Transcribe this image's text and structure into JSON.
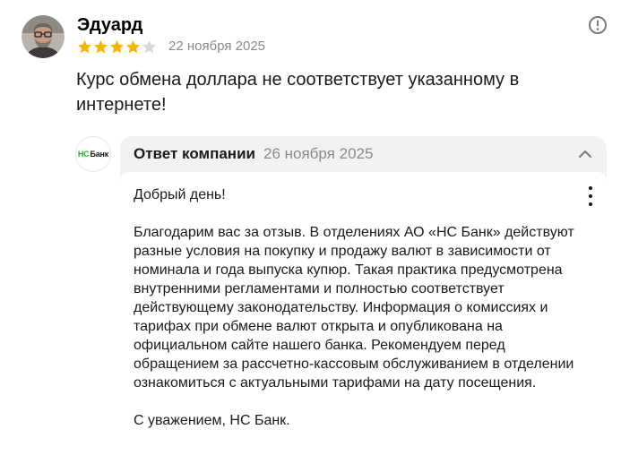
{
  "review": {
    "author_name": "Эдуард",
    "rating": 4,
    "max_rating": 5,
    "date": "22 ноября 2025",
    "text": "Курс обмена доллара не соответствует указанному в интернете!",
    "icons": {
      "avatar": "avatar-photo",
      "more": "info-circle-icon"
    }
  },
  "company_reply": {
    "logo_text_ns": "НС",
    "logo_text_bank": "Банк",
    "title": "Ответ компании",
    "date": "26 ноября 2025",
    "paragraphs": [
      "Добрый день!",
      "Благодарим вас за отзыв. В отделениях АО «НС Банк» действуют разные условия на покупку и продажу валют в зависимости от номинала и года выпуска купюр. Такая практика предусмотрена внутренними регламентами и полностью соответствует действующему законодательству. Информация о комиссиях и тарифах при обмене валют открыта и опубликована на официальном сайте нашего банка. Рекомендуем перед обращением за рассчетно-кассовым обслуживанием в отделении ознакомиться с актуальными тарифами на дату посещения.",
      "С уважением, НС Банк."
    ],
    "icons": {
      "collapse": "chevron-up-icon",
      "menu": "kebab-menu-icon"
    }
  },
  "colors": {
    "star_filled": "#f7b500",
    "star_empty": "#d9d9d9",
    "reply_bg": "#f2f2f2",
    "muted_text": "#8a8a8a",
    "logo_green": "#2aa63b"
  }
}
